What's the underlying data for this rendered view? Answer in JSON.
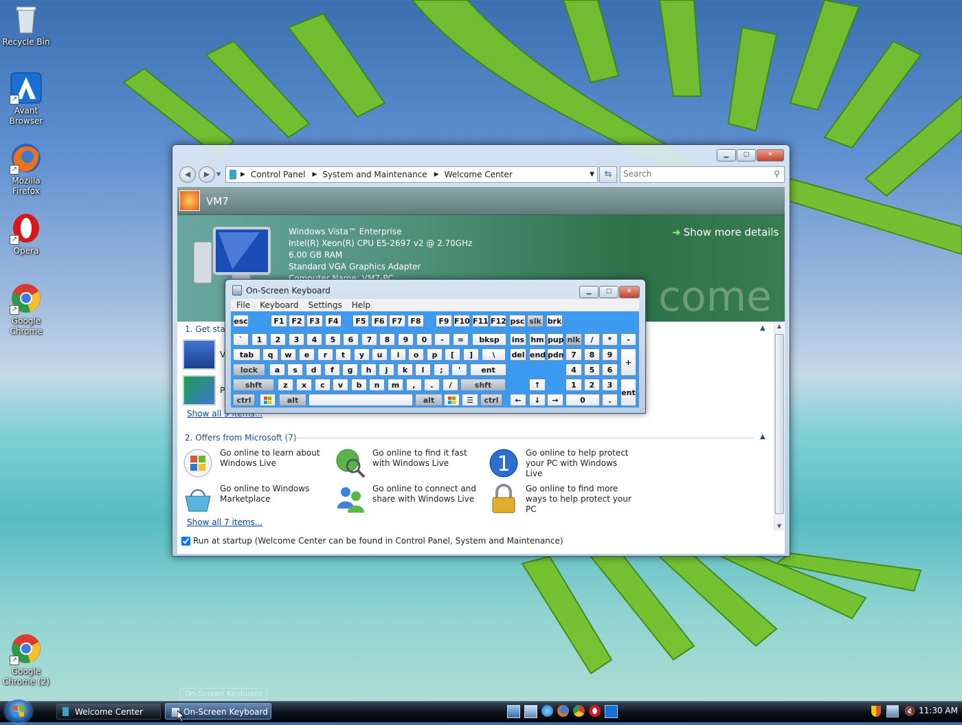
{
  "desktop": {
    "icons": [
      {
        "label": "Recycle Bin"
      },
      {
        "label": "Avant Browser"
      },
      {
        "label": "Mozilla Firefox"
      },
      {
        "label": "Opera"
      },
      {
        "label": "Google Chrome"
      },
      {
        "label": "Google Chrome (2)"
      }
    ]
  },
  "window": {
    "address": {
      "segments": [
        "Control Panel",
        "System and Maintenance",
        "Welcome Center"
      ]
    },
    "search_placeholder": "Search",
    "computer_name_title": "VM7",
    "system_info": [
      "Windows Vista™ Enterprise",
      "Intel(R) Xeon(R) CPU E5-2697 v2 @ 2.70GHz",
      "6.00 GB RAM",
      "Standard VGA Graphics Adapter",
      "Computer Name: VM7-PC"
    ],
    "show_more": "Show more details",
    "banner_watermark": "come",
    "section1": {
      "title": "1. Get start",
      "show_all": "Show all 9 items...",
      "item_initials": [
        "V",
        "P"
      ]
    },
    "section2": {
      "title": "2. Offers from Microsoft (7)",
      "items": [
        "Go online to learn about Windows Live",
        "Go online to find it fast with Windows Live",
        "Go online to help protect your PC with Windows Live",
        "Go online to Windows Marketplace",
        "Go online to connect and share with Windows Live",
        "Go online to find more ways to help protect your PC"
      ],
      "show_all": "Show all 7 items..."
    },
    "startup_label": "Run at startup (Welcome Center can be found in Control Panel, System and Maintenance)",
    "startup_checked": true
  },
  "osk": {
    "title": "On-Screen Keyboard",
    "menu": [
      "File",
      "Keyboard",
      "Settings",
      "Help"
    ],
    "rows": {
      "fn": [
        "esc",
        "F1",
        "F2",
        "F3",
        "F4",
        "F5",
        "F6",
        "F7",
        "F8",
        "F9",
        "F10",
        "F11",
        "F12",
        "psc",
        "slk",
        "brk"
      ],
      "num": [
        "`",
        "1",
        "2",
        "3",
        "4",
        "5",
        "6",
        "7",
        "8",
        "9",
        "0",
        "-",
        "=",
        "bksp",
        "ins",
        "hm",
        "pup",
        "nlk",
        "/",
        "*",
        "-"
      ],
      "top": [
        "tab",
        "q",
        "w",
        "e",
        "r",
        "t",
        "y",
        "u",
        "i",
        "o",
        "p",
        "[",
        "]",
        "\\",
        "del",
        "end",
        "pdn",
        "7",
        "8",
        "9",
        "+"
      ],
      "home": [
        "lock",
        "a",
        "s",
        "d",
        "f",
        "g",
        "h",
        "j",
        "k",
        "l",
        ";",
        "'",
        "ent",
        "4",
        "5",
        "6"
      ],
      "shift": [
        "shft",
        "z",
        "x",
        "c",
        "v",
        "b",
        "n",
        "m",
        ",",
        ".",
        "/",
        "shft",
        "↑",
        "1",
        "2",
        "3",
        "ent"
      ],
      "bottom": [
        "ctrl",
        "alt",
        "alt",
        "ctrl",
        "←",
        "↓",
        "→",
        "0",
        "."
      ]
    }
  },
  "taskbar": {
    "buttons": [
      "Welcome Center",
      "On-Screen Keyboard"
    ],
    "tooltip": "On-Screen Keyboard",
    "clock": "11:30 AM"
  }
}
